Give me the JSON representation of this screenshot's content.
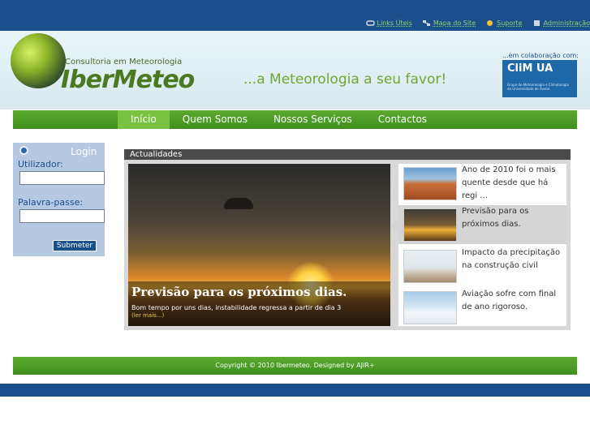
{
  "toplinks": [
    {
      "label": "Links Úteis",
      "icon": "links-icon"
    },
    {
      "label": "Mapa do Site",
      "icon": "sitemap-icon"
    },
    {
      "label": "Suporte",
      "icon": "support-icon"
    },
    {
      "label": "Administração",
      "icon": "admin-icon"
    }
  ],
  "header": {
    "tagline": "Consultoria em Meteorologia",
    "brand": "IberMeteo",
    "slogan": "...a Meteorologia a seu favor!",
    "collab_label": "...em colaboração com:",
    "collab_logo": "CliM UA",
    "collab_sub": "Grupo de Meteorologia e Climatologia da Universidade de Aveiro"
  },
  "nav": [
    {
      "label": "Início",
      "active": true
    },
    {
      "label": "Quem Somos"
    },
    {
      "label": "Nossos Serviços"
    },
    {
      "label": "Contactos"
    }
  ],
  "login": {
    "title": "Login",
    "user_label": "Utilizador:",
    "user_value": "",
    "pass_label": "Palavra-passe:",
    "pass_value": "",
    "submit": "Submeter"
  },
  "news": {
    "heading": "Actualidades",
    "feature": {
      "title": "Previsão para os próximos dias.",
      "text": "Bom tempo por uns dias, instabilidade regressa a partir de dia 3",
      "more": "(ler mais...)"
    },
    "items": [
      {
        "text": "Ano de 2010 foi o mais quente desde que há regi ..."
      },
      {
        "text": "Previsão para os próximos dias."
      },
      {
        "text": "Impacto da precipitação na construção civil"
      },
      {
        "text": "Aviação sofre com final de ano rigoroso."
      }
    ]
  },
  "footer": {
    "text": "Copyright © 2010 Ibermeteo. Designed by AJIR+"
  },
  "colors": {
    "top_blue": "#1a4f8c",
    "nav_green": "#4a9e28",
    "link_green": "#8fd36a"
  }
}
